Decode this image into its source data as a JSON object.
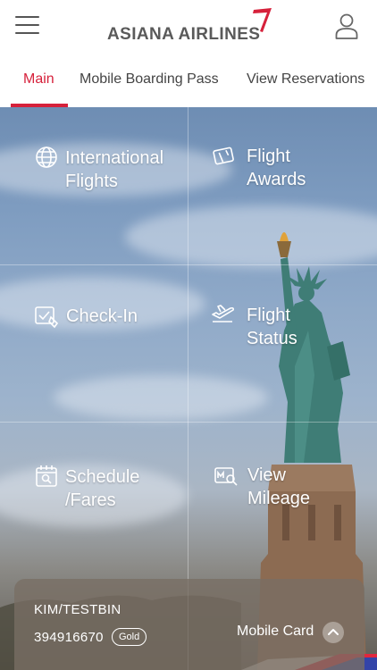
{
  "header": {
    "logo_text": "ASIANA AIRLINES",
    "menu_icon": "hamburger-menu-icon",
    "user_icon": "user-profile-icon",
    "logo_accent_color": "#d6213b"
  },
  "tabs": [
    {
      "label": "Main",
      "active": true
    },
    {
      "label": "Mobile Boarding Pass",
      "active": false
    },
    {
      "label": "View Reservations",
      "active": false
    }
  ],
  "menu": [
    {
      "label": "International\nFlights",
      "icon": "globe-icon"
    },
    {
      "label": "Flight\nAwards",
      "icon": "award-ticket-icon"
    },
    {
      "label": "Check-In",
      "icon": "check-in-icon"
    },
    {
      "label": "Flight\nStatus",
      "icon": "plane-takeoff-icon"
    },
    {
      "label": "Schedule\n/Fares",
      "icon": "calendar-icon"
    },
    {
      "label": "View\nMileage",
      "icon": "mileage-icon"
    }
  ],
  "card": {
    "name": "KIM/TESTBIN",
    "number": "394916670",
    "tier": "Gold",
    "label": "Mobile Card",
    "toggle_icon": "chevron-up-icon"
  },
  "colors": {
    "accent": "#d6213b",
    "text": "#444444"
  }
}
